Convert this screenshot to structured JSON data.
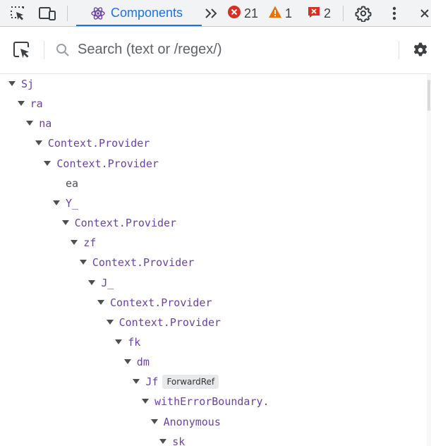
{
  "topbar": {
    "tab_label": "Components",
    "errors_count": "21",
    "warnings_count": "1",
    "issues_count": "2",
    "colors": {
      "accent": "#1a73e8",
      "error": "#d93025",
      "warning": "#e8710a"
    },
    "icons": [
      "inspect-element-icon",
      "device-toolbar-icon",
      "react-icon",
      "more-tabs-icon",
      "error-icon",
      "warning-icon",
      "issues-icon",
      "settings-icon",
      "more-menu-icon"
    ]
  },
  "toolbar": {
    "search_placeholder": "Search (text or /regex/)",
    "icons": [
      "select-component-icon",
      "search-icon",
      "settings-icon"
    ]
  },
  "tree": {
    "component_color": "#6b43a8",
    "rows": [
      {
        "label": "Sj",
        "depth": 0,
        "expanded": true
      },
      {
        "label": "ra",
        "depth": 1,
        "expanded": true
      },
      {
        "label": "na",
        "depth": 2,
        "expanded": true
      },
      {
        "label": "Context.Provider",
        "depth": 3,
        "expanded": true
      },
      {
        "label": "Context.Provider",
        "depth": 4,
        "expanded": true
      },
      {
        "label": "ea",
        "depth": 5,
        "expanded": false,
        "leaf": true
      },
      {
        "label": "Y_",
        "depth": 5,
        "expanded": true
      },
      {
        "label": "Context.Provider",
        "depth": 6,
        "expanded": true
      },
      {
        "label": "zf",
        "depth": 7,
        "expanded": true
      },
      {
        "label": "Context.Provider",
        "depth": 8,
        "expanded": true
      },
      {
        "label": "J_",
        "depth": 9,
        "expanded": true
      },
      {
        "label": "Context.Provider",
        "depth": 10,
        "expanded": true
      },
      {
        "label": "Context.Provider",
        "depth": 11,
        "expanded": true
      },
      {
        "label": "fk",
        "depth": 12,
        "expanded": true
      },
      {
        "label": "dm",
        "depth": 13,
        "expanded": true
      },
      {
        "label": "Jf",
        "depth": 14,
        "expanded": true,
        "badge": "ForwardRef"
      },
      {
        "label": "withErrorBoundary.",
        "depth": 15,
        "expanded": true
      },
      {
        "label": "Anonymous",
        "depth": 16,
        "expanded": true
      },
      {
        "label": "sk",
        "depth": 17,
        "expanded": true
      }
    ]
  }
}
